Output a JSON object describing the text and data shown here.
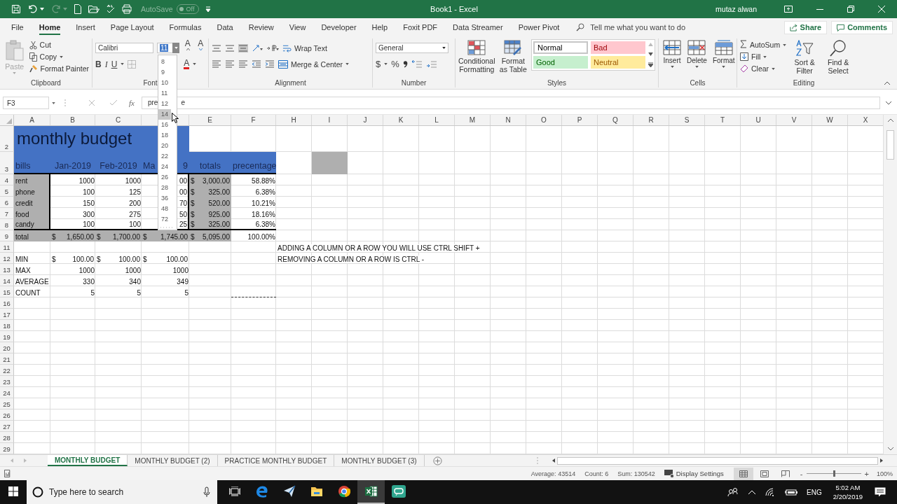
{
  "title_bar": {
    "autosave_label": "AutoSave",
    "autosave": {
      "on": false,
      "label": "Off"
    },
    "title": "Book1  -  Excel",
    "user": "mutaz alwan"
  },
  "ribbon_tabs": [
    {
      "label": "File",
      "selected": false
    },
    {
      "label": "Home",
      "selected": true
    },
    {
      "label": "Insert",
      "selected": false
    },
    {
      "label": "Page Layout",
      "selected": false
    },
    {
      "label": "Formulas",
      "selected": false
    },
    {
      "label": "Data",
      "selected": false
    },
    {
      "label": "Review",
      "selected": false
    },
    {
      "label": "View",
      "selected": false
    },
    {
      "label": "Developer",
      "selected": false
    },
    {
      "label": "Help",
      "selected": false
    },
    {
      "label": "Foxit PDF",
      "selected": false
    },
    {
      "label": "Data Streamer",
      "selected": false
    },
    {
      "label": "Power Pivot",
      "selected": false
    }
  ],
  "tell_me": {
    "placeholder": "Tell me what you want to do"
  },
  "share": "Share",
  "comments": "Comments",
  "ribbon": {
    "clipboard": {
      "label": "Clipboard",
      "paste": "Paste",
      "cut": "Cut",
      "copy": "Copy",
      "format_painter": "Format Painter"
    },
    "font": {
      "label": "Font",
      "font_name": "Calibri",
      "font_size": {
        "value": "11",
        "highlighted": true
      },
      "grow": "A",
      "shrink": "A",
      "bold": "B",
      "italic": "I",
      "underline": "U",
      "font_color": "A"
    },
    "alignment": {
      "label": "Alignment",
      "wrap_text": "Wrap Text",
      "merge": "Merge & Center"
    },
    "number": {
      "label": "Number",
      "format": "General",
      "currency": "$",
      "percent": "%"
    },
    "styles": {
      "label": "Styles",
      "conditional": "Conditional Formatting",
      "format_table": "Format as Table",
      "swatches": [
        {
          "label": "Normal",
          "kind": "normal"
        },
        {
          "label": "Bad",
          "kind": "bad"
        },
        {
          "label": "Good",
          "kind": "good"
        },
        {
          "label": "Neutral",
          "kind": "neutral"
        }
      ]
    },
    "cells": {
      "label": "Cells",
      "buttons": [
        {
          "label": "Insert",
          "kind": "insert"
        },
        {
          "label": "Delete",
          "kind": "delete"
        },
        {
          "label": "Format",
          "kind": "format"
        }
      ]
    },
    "editing": {
      "label": "Editing",
      "autosum": "AutoSum",
      "fill": "Fill",
      "clear": "Clear",
      "sort": "Sort & Filter",
      "find": "Find & Select"
    }
  },
  "font_size_list": [
    {
      "label": "8",
      "hovered": false
    },
    {
      "label": "9",
      "hovered": false
    },
    {
      "label": "10",
      "hovered": false
    },
    {
      "label": "11",
      "hovered": false
    },
    {
      "label": "12",
      "hovered": false
    },
    {
      "label": "14",
      "hovered": true
    },
    {
      "label": "16",
      "hovered": false
    },
    {
      "label": "18",
      "hovered": false
    },
    {
      "label": "20",
      "hovered": false
    },
    {
      "label": "22",
      "hovered": false
    },
    {
      "label": "24",
      "hovered": false
    },
    {
      "label": "26",
      "hovered": false
    },
    {
      "label": "28",
      "hovered": false
    },
    {
      "label": "36",
      "hovered": false
    },
    {
      "label": "48",
      "hovered": false
    },
    {
      "label": "72",
      "hovered": false
    }
  ],
  "formula_bar": {
    "name_box": "F3",
    "fx": "fx",
    "value_parts": [
      "pre",
      "e"
    ]
  },
  "columns": [
    {
      "label": "A"
    },
    {
      "label": "B"
    },
    {
      "label": "C"
    },
    {},
    {
      "label": "E"
    },
    {
      "label": "F"
    },
    {
      "label": "H"
    },
    {
      "label": "I"
    },
    {
      "label": "J"
    },
    {
      "label": "K"
    },
    {
      "label": "L"
    },
    {
      "label": "M"
    },
    {
      "label": "N"
    },
    {
      "label": "O"
    },
    {
      "label": "P"
    },
    {
      "label": "Q"
    },
    {
      "label": "R"
    },
    {
      "label": "S"
    },
    {
      "label": "T"
    },
    {
      "label": "U"
    },
    {
      "label": "V"
    },
    {
      "label": "W"
    },
    {
      "label": "X"
    }
  ],
  "rows": [
    {
      "label": "2",
      "kind": "title",
      "cells": [
        {
          "text": "monthly budget",
          "kind": "title",
          "color": "#4472c4"
        },
        {
          "color": "#4472c4"
        },
        {
          "color": "#4472c4"
        },
        {
          "color": "#4472c4"
        }
      ]
    },
    {
      "label": "3",
      "kind": "header",
      "cells": [
        {
          "text": "bills",
          "kind": "text",
          "color": "#4472c4"
        },
        {
          "text": "Jan-2019",
          "kind": "center",
          "color": "#4472c4"
        },
        {
          "text": "Feb-2019",
          "kind": "center",
          "color": "#4472c4"
        },
        {
          "parts": [
            "Ma",
            "9"
          ],
          "kind": "split",
          "color": "#4472c4"
        },
        {
          "text": "totals",
          "kind": "center",
          "color": "#4472c4"
        },
        {
          "text": "precentage",
          "kind": "text",
          "color": "#4472c4"
        },
        {},
        {
          "color": "#afafaf"
        }
      ]
    },
    {
      "label": "4",
      "kind": "data",
      "cells": [
        {
          "text": "rent",
          "kind": "text",
          "color": "#afafaf"
        },
        {
          "text": "1000",
          "kind": "number"
        },
        {
          "text": "1000",
          "kind": "number"
        },
        {
          "text": "00",
          "kind": "number"
        },
        {
          "cur": "$",
          "text": "3,000.00",
          "kind": "money",
          "color": "#afafaf"
        },
        {
          "text": "58.88%",
          "kind": "number"
        }
      ]
    },
    {
      "label": "5",
      "kind": "data",
      "cells": [
        {
          "text": "phone",
          "kind": "text",
          "color": "#afafaf"
        },
        {
          "text": "100",
          "kind": "number"
        },
        {
          "text": "125",
          "kind": "number"
        },
        {
          "text": "00",
          "kind": "number"
        },
        {
          "cur": "$",
          "text": "325.00",
          "kind": "money",
          "color": "#afafaf"
        },
        {
          "text": "6.38%",
          "kind": "number"
        }
      ]
    },
    {
      "label": "6",
      "kind": "data",
      "cells": [
        {
          "text": "credit",
          "kind": "text",
          "color": "#afafaf"
        },
        {
          "text": "150",
          "kind": "number"
        },
        {
          "text": "200",
          "kind": "number"
        },
        {
          "text": "70",
          "kind": "number"
        },
        {
          "cur": "$",
          "text": "520.00",
          "kind": "money",
          "color": "#afafaf"
        },
        {
          "text": "10.21%",
          "kind": "number"
        }
      ]
    },
    {
      "label": "7",
      "kind": "data",
      "cells": [
        {
          "text": "food",
          "kind": "text",
          "color": "#afafaf"
        },
        {
          "text": "300",
          "kind": "number"
        },
        {
          "text": "275",
          "kind": "number"
        },
        {
          "text": "50",
          "kind": "number"
        },
        {
          "cur": "$",
          "text": "925.00",
          "kind": "money",
          "color": "#afafaf"
        },
        {
          "text": "18.16%",
          "kind": "number"
        }
      ]
    },
    {
      "label": "8",
      "kind": "data",
      "cells": [
        {
          "text": "candy",
          "kind": "text",
          "color": "#afafaf"
        },
        {
          "text": "100",
          "kind": "number"
        },
        {
          "text": "100",
          "kind": "number"
        },
        {
          "text": "25",
          "kind": "number"
        },
        {
          "cur": "$",
          "text": "325.00",
          "kind": "money",
          "color": "#afafaf"
        },
        {
          "text": "6.38%",
          "kind": "number"
        }
      ]
    },
    {
      "label": "9",
      "kind": "total",
      "cells": [
        {
          "text": "total",
          "kind": "text",
          "color": "#afafaf"
        },
        {
          "cur": "$",
          "text": "1,650.00",
          "kind": "money",
          "color": "#afafaf"
        },
        {
          "cur": "$",
          "text": "1,700.00",
          "kind": "money",
          "color": "#afafaf"
        },
        {
          "cur": "$",
          "text": "1,745.00",
          "kind": "money",
          "color": "#afafaf"
        },
        {
          "cur": "$",
          "text": "5,095.00",
          "kind": "money",
          "color": "#afafaf"
        },
        {
          "text": "100.00%",
          "kind": "number"
        }
      ]
    },
    {
      "label": "11",
      "kind": "plain",
      "cells": [
        {},
        {},
        {},
        {},
        {},
        {},
        {
          "text": "ADDING A COLUMN OR A ROW YOU WILL USE CTRL SHIFT +",
          "kind": "text"
        }
      ]
    },
    {
      "label": "12",
      "kind": "plain",
      "cells": [
        {
          "text": "MIN",
          "kind": "text"
        },
        {
          "cur": "$",
          "text": "100.00",
          "kind": "money"
        },
        {
          "cur": "$",
          "text": "100.00",
          "kind": "money"
        },
        {
          "cur": "$",
          "text": "100.00",
          "kind": "money"
        },
        {},
        {},
        {
          "text": "REMOVING A COLUMN OR A ROW  IS CTRL -",
          "kind": "text"
        }
      ]
    },
    {
      "label": "13",
      "kind": "plain",
      "cells": [
        {
          "text": "MAX",
          "kind": "text"
        },
        {
          "text": "1000",
          "kind": "number"
        },
        {
          "text": "1000",
          "kind": "number"
        },
        {
          "text": "1000",
          "kind": "number"
        }
      ]
    },
    {
      "label": "14",
      "kind": "plain",
      "cells": [
        {
          "text": "AVERAGE",
          "kind": "text"
        },
        {
          "text": "330",
          "kind": "number"
        },
        {
          "text": "340",
          "kind": "number"
        },
        {
          "text": "349",
          "kind": "number"
        }
      ]
    },
    {
      "label": "15",
      "kind": "plain",
      "cells": [
        {
          "text": "COUNT",
          "kind": "text"
        },
        {
          "text": "5",
          "kind": "number"
        },
        {
          "text": "5",
          "kind": "number"
        },
        {
          "text": "5",
          "kind": "number"
        },
        {},
        {
          "copied": true
        }
      ]
    },
    {
      "label": "16",
      "kind": "plain"
    },
    {
      "label": "17",
      "kind": "plain"
    },
    {
      "label": "18",
      "kind": "plain"
    },
    {
      "label": "19",
      "kind": "plain"
    },
    {
      "label": "20",
      "kind": "plain"
    },
    {
      "label": "21",
      "kind": "plain"
    },
    {
      "label": "22",
      "kind": "plain"
    },
    {
      "label": "23",
      "kind": "plain"
    },
    {
      "label": "24",
      "kind": "plain"
    },
    {
      "label": "25",
      "kind": "plain"
    },
    {
      "label": "26",
      "kind": "plain"
    },
    {
      "label": "27",
      "kind": "plain"
    },
    {
      "label": "28",
      "kind": "plain"
    },
    {
      "label": "29",
      "kind": "plain"
    }
  ],
  "sheet_tabs": [
    {
      "label": "MONTHLY BUDGET",
      "selected": true
    },
    {
      "label": "MONTHLY BUDGET (2)",
      "selected": false
    },
    {
      "label": "PRACTICE MONTHLY BUDGET",
      "selected": false
    },
    {
      "label": "MONTHLY BUDGET (3)",
      "selected": false
    }
  ],
  "status_bar": {
    "average": "Average: 43514",
    "count": "Count: 6",
    "sum": "Sum: 130542",
    "display_settings": "Display Settings",
    "views": [
      {
        "kind": "normal",
        "selected": true
      },
      {
        "kind": "layout",
        "selected": false
      },
      {
        "kind": "break",
        "selected": false
      }
    ],
    "zoom_minus": "-",
    "zoom_plus": "+",
    "zoom": {
      "level": 0.5
    },
    "zoom_label": "100%"
  },
  "taskbar": {
    "search": {
      "placeholder": "Type here to search"
    },
    "apps": [
      {
        "kind": "task_view",
        "active": false
      },
      {
        "kind": "edge",
        "active": false
      },
      {
        "kind": "plane",
        "active": false
      },
      {
        "kind": "folder",
        "active": false
      },
      {
        "kind": "chrome",
        "active": false
      },
      {
        "kind": "excel",
        "active": true
      },
      {
        "kind": "chat",
        "active": false
      }
    ],
    "language": "ENG",
    "time": "5:02 AM",
    "date": "2/20/2019"
  }
}
